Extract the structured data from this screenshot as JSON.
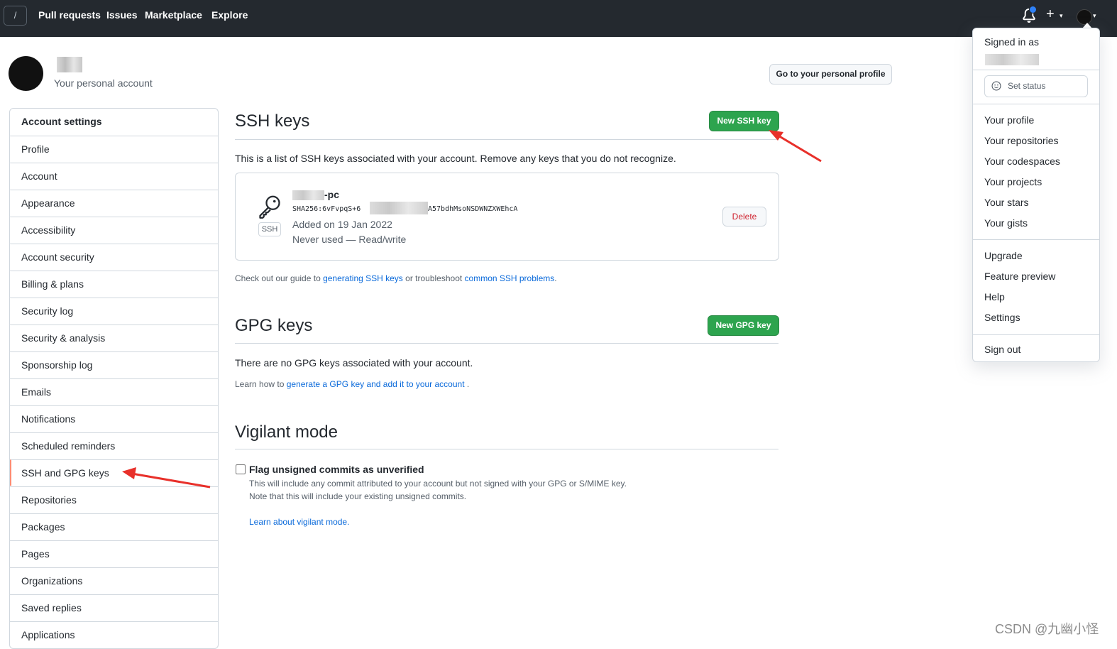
{
  "header": {
    "logo_glyph": "/",
    "nav": [
      "Pull requests",
      "Issues",
      "Marketplace",
      "Explore"
    ],
    "plus": "+",
    "caret": "▾"
  },
  "account": {
    "subtitle": "Your personal account",
    "profile_button": "Go to your personal profile"
  },
  "sidebar": {
    "items": [
      "Account settings",
      "Profile",
      "Account",
      "Appearance",
      "Accessibility",
      "Account security",
      "Billing & plans",
      "Security log",
      "Security & analysis",
      "Sponsorship log",
      "Emails",
      "Notifications",
      "Scheduled reminders",
      "SSH and GPG keys",
      "Repositories",
      "Packages",
      "Pages",
      "Organizations",
      "Saved replies",
      "Applications"
    ],
    "active": "SSH and GPG keys"
  },
  "ssh": {
    "title": "SSH keys",
    "new_button": "New SSH key",
    "description": "This is a list of SSH keys associated with your account. Remove any keys that you do not recognize.",
    "key": {
      "badge": "SSH",
      "name_suffix": "-pc",
      "fingerprint_start": "SHA256:6vFvpqS+6",
      "fingerprint_end": "A57bdhMsoNSDWNZXWEhcA",
      "added": "Added on 19 Jan 2022",
      "usage": "Never used — Read/write",
      "delete": "Delete"
    },
    "guide_prefix": "Check out our guide to ",
    "guide_link1": "generating SSH keys",
    "guide_mid": " or troubleshoot ",
    "guide_link2": "common SSH problems",
    "guide_suffix": "."
  },
  "gpg": {
    "title": "GPG keys",
    "new_button": "New GPG key",
    "empty": "There are no GPG keys associated with your account.",
    "learn_prefix": "Learn how to ",
    "learn_link": "generate a GPG key and add it to your account",
    "learn_suffix": " ."
  },
  "vigilant": {
    "title": "Vigilant mode",
    "checkbox_label": "Flag unsigned commits as unverified",
    "checked": false,
    "desc1": "This will include any commit attributed to your account but not signed with your GPG or S/MIME key.",
    "desc2": "Note that this will include your existing unsigned commits.",
    "learn_link": "Learn about vigilant mode."
  },
  "dropdown": {
    "signed_in": "Signed in as",
    "set_status": "Set status",
    "group1": [
      "Your profile",
      "Your repositories",
      "Your codespaces",
      "Your projects",
      "Your stars",
      "Your gists"
    ],
    "group2": [
      "Upgrade",
      "Feature preview",
      "Help",
      "Settings"
    ],
    "sign_out": "Sign out"
  },
  "watermark": "CSDN @九幽小怪",
  "colors": {
    "header_bg": "#24292f",
    "primary_green": "#2da44e",
    "link_blue": "#0969da",
    "danger_red": "#cf222e",
    "active_indicator": "#fd8c73",
    "annotation_arrow": "#e8302a"
  }
}
